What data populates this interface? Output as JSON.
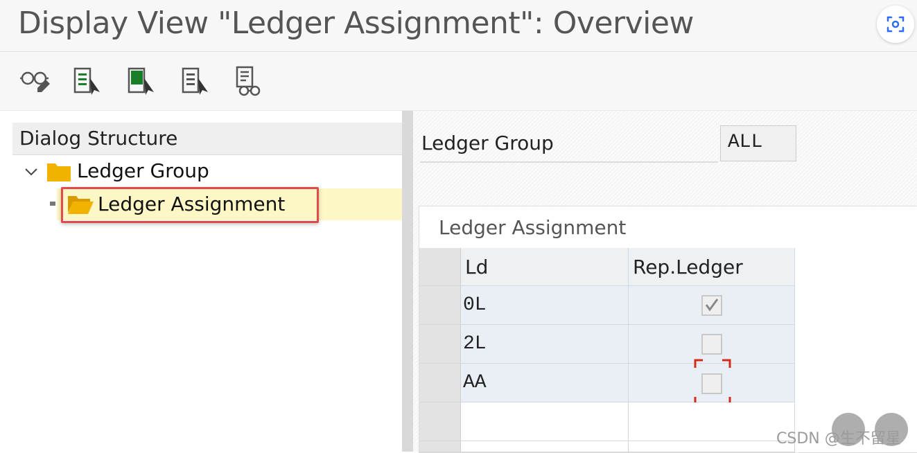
{
  "window": {
    "title": "Display View \"Ledger Assignment\": Overview"
  },
  "toolbar": {
    "icons": [
      "display-change-icon",
      "select-all-icon",
      "select-block-icon",
      "deselect-all-icon",
      "print-preview-icon"
    ]
  },
  "dialog_structure": {
    "title": "Dialog Structure",
    "items": [
      {
        "label": "Ledger Group",
        "level": 0,
        "expanded": true
      },
      {
        "label": "Ledger Assignment",
        "level": 1,
        "selected": true
      }
    ]
  },
  "ledger_group": {
    "label": "Ledger Group",
    "value": "ALL"
  },
  "assignment": {
    "title": "Ledger Assignment",
    "columns": [
      "Ld",
      "Rep.Ledger"
    ],
    "rows": [
      {
        "ld": "0L",
        "rep_ledger": true
      },
      {
        "ld": "2L",
        "rep_ledger": false
      },
      {
        "ld": "AA",
        "rep_ledger": false
      }
    ]
  },
  "watermark": {
    "text": "CSDN @生不留星"
  },
  "colors": {
    "highlight_box": "#e04a4a",
    "selected_row": "#fdf7c5",
    "folder": "#f2b300",
    "cell_bg": "#e9eff5"
  }
}
